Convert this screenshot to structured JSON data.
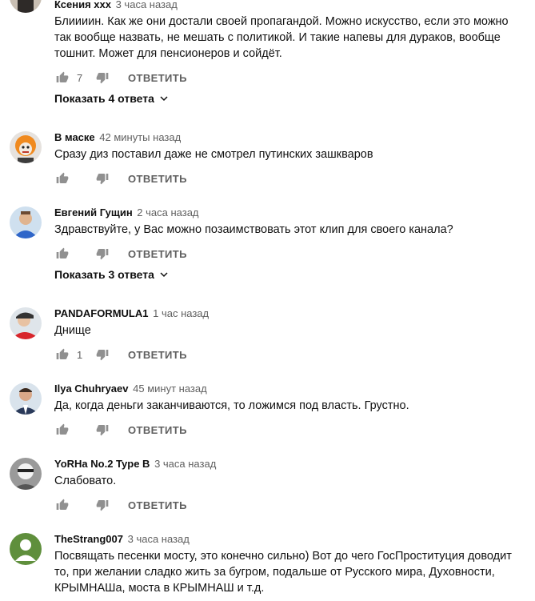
{
  "reply_label": "ОТВЕТИТЬ",
  "comments": [
    {
      "author": "Ксения xxx",
      "time": "3 часа назад",
      "text": "Блиииин. Как же они достали своей пропагандой. Можно искусство, если это можно так вообще назвать, не мешать с политикой. И такие напевы для дураков, вообще тошнит. Может для пенсионеров и сойдёт.",
      "likes": "7",
      "replies_label": "Показать 4 ответа",
      "avatar_icon": "avatar-user-photo-icon"
    },
    {
      "author": "В маске",
      "time": "42 минуты назад",
      "text": "Сразу диз поставил даже не смотрел путинских зашкваров",
      "likes": "",
      "replies_label": "",
      "avatar_icon": "avatar-clown-mask-icon"
    },
    {
      "author": "Евгений Гущин",
      "time": "2 часа назад",
      "text": "Здравствуйте, у Вас можно позаимствовать этот клип для своего канала?",
      "likes": "",
      "replies_label": "Показать 3 ответа",
      "avatar_icon": "avatar-man-blue-shirt-icon"
    },
    {
      "author": "PANDAFORMULA1",
      "time": "1 час назад",
      "text": "Днище",
      "likes": "1",
      "replies_label": "",
      "avatar_icon": "avatar-racer-red-icon"
    },
    {
      "author": "Ilya Chuhryaev",
      "time": "45 минут назад",
      "text": "Да, когда деньги заканчиваются, то ложимся под власть. Грустно.",
      "likes": "",
      "replies_label": "",
      "avatar_icon": "avatar-man-suit-icon"
    },
    {
      "author": "YoRHa No.2 Type B",
      "time": "3 часа назад",
      "text": "Слабовато.",
      "likes": "",
      "replies_label": "",
      "avatar_icon": "avatar-character-white-icon"
    },
    {
      "author": "TheStrang007",
      "time": "3 часа назад",
      "text": "Посвящать песенки мосту, это конечно сильно) Вот до чего ГосПроституция доводит то, при желании сладко жить за бугром, подальше от Русского мира, Духовности, КРЫМНАШа, моста в КРЫМНАШ и т.д.",
      "likes": "",
      "replies_label": "",
      "avatar_icon": "avatar-default-green-icon"
    }
  ],
  "colors": {
    "text": "#0f0f0f",
    "secondary": "#606060",
    "default_avatar_bg": "#5f8f3c"
  }
}
